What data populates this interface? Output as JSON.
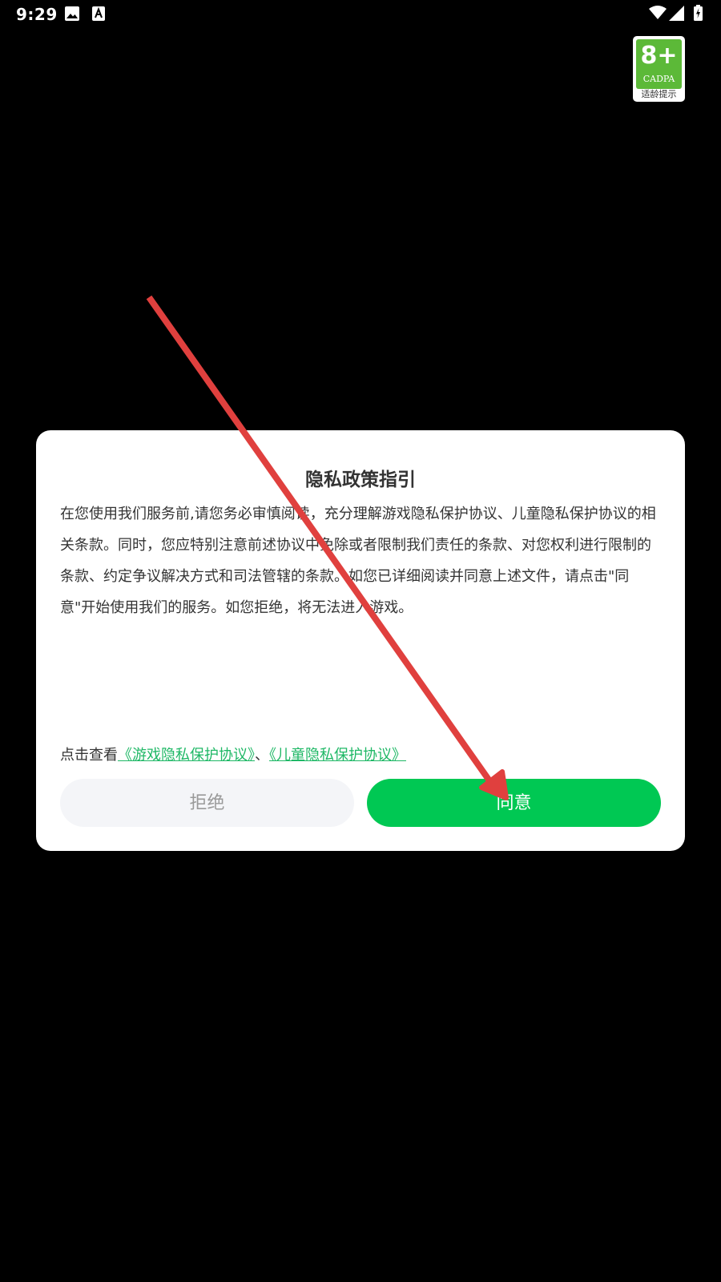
{
  "status_bar": {
    "time": "9:29",
    "icons": [
      "image-icon",
      "keyboard-icon",
      "wifi-icon",
      "signal-icon",
      "battery-charging-icon"
    ]
  },
  "age_badge": {
    "rating": "8+",
    "org": "CADPA",
    "caption": "适龄提示",
    "color": "#5cb938"
  },
  "dialog": {
    "title": "隐私政策指引",
    "body": "在您使用我们服务前,请您务必审慎阅读，充分理解游戏隐私保护协议、儿童隐私保护协议的相关条款。同时，您应特别注意前述协议中免除或者限制我们责任的条款、对您权利进行限制的条款、约定争议解决方式和司法管辖的条款。如您已详细阅读并同意上述文件，请点击\"同意\"开始使用我们的服务。如您拒绝，将无法进入游戏。",
    "links_prefix": "点击查看",
    "link_game_privacy": "《游戏隐私保护协议》",
    "links_separator": "、",
    "link_child_privacy": "《儿童隐私保护协议》",
    "reject_label": "拒绝",
    "agree_label": "同意",
    "colors": {
      "link": "#1fb866",
      "agree_button": "#00c853",
      "reject_button": "#f4f5f8",
      "annotation_arrow": "#e0403e"
    }
  }
}
